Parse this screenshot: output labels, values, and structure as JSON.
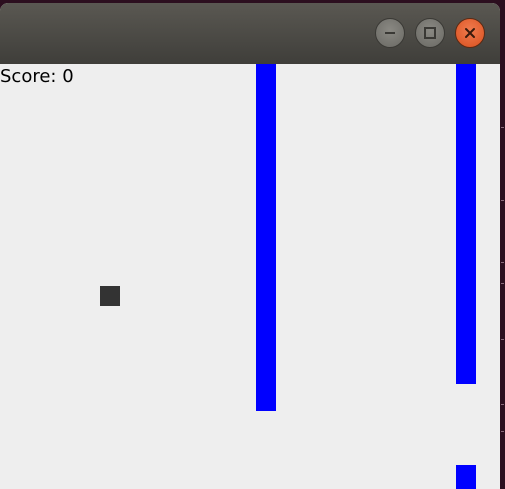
{
  "window": {
    "buttons": {
      "minimize": "minimize-icon",
      "maximize": "maximize-icon",
      "close": "close-icon"
    }
  },
  "game": {
    "score_label": "Score: 0",
    "colors": {
      "background": "#eeeeee",
      "pipe": "#0000ff",
      "player": "#333333",
      "close_button": "#e95420"
    }
  }
}
